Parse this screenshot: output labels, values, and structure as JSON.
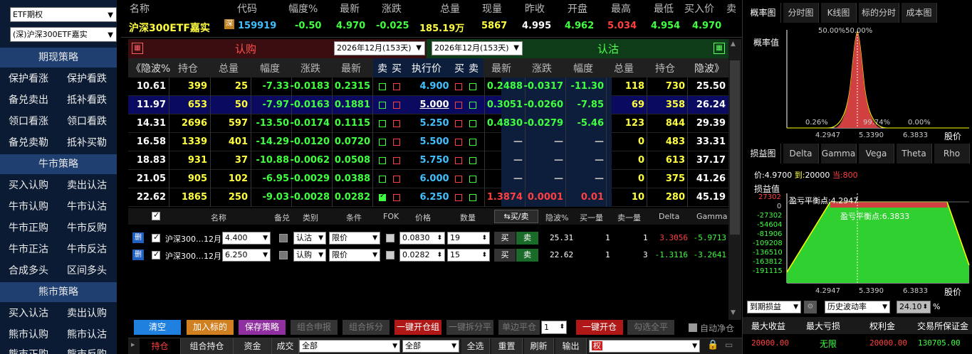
{
  "sidebar": {
    "product_select": "ETF期权",
    "underlying_select": "(深)沪深300ETF嘉实",
    "sections": [
      {
        "title": "期现策略",
        "items": [
          "保护看涨",
          "保护看跌",
          "备兑卖出",
          "抵补看跌",
          "领口看涨",
          "领口看跌",
          "备兑卖勒",
          "抵补买勒"
        ]
      },
      {
        "title": "牛市策略",
        "items": [
          "买入认购",
          "卖出认沽",
          "牛市认购",
          "牛市认沽",
          "牛市正购",
          "牛市反购",
          "牛市正沽",
          "牛市反沽",
          "合成多头",
          "区间多头"
        ]
      },
      {
        "title": "熊市策略",
        "items": [
          "买入认沽",
          "卖出认购",
          "熊市认购",
          "熊市认沽",
          "熊市正购",
          "熊市反购"
        ]
      }
    ]
  },
  "quote": {
    "headers": [
      "名称",
      "代码",
      "幅度%",
      "最新",
      "涨跌",
      "总量",
      "现量",
      "昨收",
      "开盘",
      "最高",
      "最低",
      "买入价",
      "卖"
    ],
    "name": "沪深300ETF嘉实",
    "tag": "深",
    "code": "159919",
    "change_pct": "-0.50",
    "last": "4.970",
    "change": "-0.025",
    "volume": "185.19万",
    "cur_vol": "5867",
    "prev_close": "4.995",
    "open": "4.962",
    "high": "5.034",
    "low": "4.954",
    "bid": "4.970"
  },
  "chain": {
    "call_label": "认购",
    "put_label": "认沽",
    "call_date": "2026年12月(153天)",
    "put_date": "2026年12月(153天)",
    "headers": [
      "《隐波%",
      "持仓",
      "总量",
      "幅度",
      "涨跌",
      "最新",
      "卖",
      "买",
      "执行价",
      "买",
      "卖",
      "最新",
      "涨跌",
      "幅度",
      "总量",
      "持仓",
      "隐波》"
    ],
    "rows": [
      {
        "c_iv": "10.61",
        "c_oi": "399",
        "c_vol": "25",
        "c_pct": "-7.33",
        "c_chg": "-0.0183",
        "c_last": "0.2315",
        "strike": "4.900",
        "p_last": "0.2488",
        "p_chg": "-0.0317",
        "p_pct": "-11.30",
        "p_vol": "118",
        "p_oi": "730",
        "p_iv": "25.50"
      },
      {
        "c_iv": "11.97",
        "c_oi": "653",
        "c_vol": "50",
        "c_pct": "-7.97",
        "c_chg": "-0.0163",
        "c_last": "0.1881",
        "strike": "5.000",
        "p_last": "0.3051",
        "p_chg": "-0.0260",
        "p_pct": "-7.85",
        "p_vol": "69",
        "p_oi": "358",
        "p_iv": "26.24"
      },
      {
        "c_iv": "14.31",
        "c_oi": "2696",
        "c_vol": "597",
        "c_pct": "-13.50",
        "c_chg": "-0.0174",
        "c_last": "0.1115",
        "strike": "5.250",
        "p_last": "0.4830",
        "p_chg": "-0.0279",
        "p_pct": "-5.46",
        "p_vol": "123",
        "p_oi": "844",
        "p_iv": "29.39"
      },
      {
        "c_iv": "16.58",
        "c_oi": "1339",
        "c_vol": "401",
        "c_pct": "-14.29",
        "c_chg": "-0.0120",
        "c_last": "0.0720",
        "strike": "5.500",
        "p_last": "—",
        "p_chg": "—",
        "p_pct": "—",
        "p_vol": "0",
        "p_oi": "483",
        "p_iv": "33.31"
      },
      {
        "c_iv": "18.83",
        "c_oi": "931",
        "c_vol": "37",
        "c_pct": "-10.88",
        "c_chg": "-0.0062",
        "c_last": "0.0508",
        "strike": "5.750",
        "p_last": "—",
        "p_chg": "—",
        "p_pct": "—",
        "p_vol": "0",
        "p_oi": "613",
        "p_iv": "37.17"
      },
      {
        "c_iv": "21.05",
        "c_oi": "905",
        "c_vol": "102",
        "c_pct": "-6.95",
        "c_chg": "-0.0029",
        "c_last": "0.0388",
        "strike": "6.000",
        "p_last": "—",
        "p_chg": "—",
        "p_pct": "—",
        "p_vol": "0",
        "p_oi": "375",
        "p_iv": "41.26"
      },
      {
        "c_iv": "22.62",
        "c_oi": "1865",
        "c_vol": "250",
        "c_pct": "-9.03",
        "c_chg": "-0.0028",
        "c_last": "0.0282",
        "strike": "6.250",
        "p_last": "1.3874",
        "p_chg": "0.0001",
        "p_pct": "0.01",
        "p_vol": "10",
        "p_oi": "280",
        "p_iv": "45.19"
      }
    ]
  },
  "orders": {
    "headers": [
      "名称",
      "备兑",
      "类别",
      "条件",
      "FOK",
      "价格",
      "数量",
      "买/卖",
      "隐波%",
      "买一量",
      "卖一量",
      "Delta",
      "Gamma"
    ],
    "del_label": "删",
    "buy_label": "买",
    "sell_label": "卖",
    "rows": [
      {
        "name": "沪深300…12月",
        "strike": "4.400",
        "type": "认沽",
        "cond": "限价",
        "price": "0.0830",
        "qty": "19",
        "iv": "25.31",
        "b1": "1",
        "s1": "1",
        "delta": "3.3056",
        "gamma": "-5.9713"
      },
      {
        "name": "沪深300…12月",
        "strike": "6.250",
        "type": "认购",
        "cond": "限价",
        "price": "0.0282",
        "qty": "15",
        "iv": "22.62",
        "b1": "1",
        "s1": "3",
        "delta": "-1.3116",
        "gamma": "-3.2641"
      }
    ]
  },
  "actions": {
    "clear": "清空",
    "add_underlying": "加入标的",
    "save_strategy": "保存策略",
    "combo_report": "组合申报",
    "combo_split": "组合拆分",
    "open_combo": "一键开仓组合",
    "split_flat": "一键拆分平仓",
    "single_flat": "单边平仓",
    "qty": "1",
    "open_one": "一键开仓",
    "check_flat": "勾选全平",
    "auto_net": "自动净仓"
  },
  "bottom_tabs": {
    "items": [
      "持仓",
      "组合持仓",
      "资金",
      "成交"
    ],
    "filter1": "全部",
    "filter2": "全部",
    "select_all": "全选",
    "reset": "重置",
    "refresh": "刷新",
    "export": "输出",
    "search": "权"
  },
  "right_panel": {
    "tabs1": [
      "概率图",
      "分时图",
      "K线图",
      "标的分时",
      "成本图"
    ],
    "prob": {
      "title": "概率值",
      "top_label": "50.00%50.00%",
      "left_pct": "0.26%",
      "mid_pct": "99.74%",
      "right_pct": "0.00%",
      "xticks": [
        "4.2947",
        "5.3390",
        "6.3833"
      ],
      "xlabel": "股价"
    },
    "tabs2": [
      "损益图",
      "Delta",
      "Gamma",
      "Vega",
      "Theta",
      "Rho"
    ],
    "pl": {
      "price_label": "价:",
      "price": "4.9700",
      "to_label": "到:",
      "to": "20000",
      "cur_label": "当:",
      "cur": "800",
      "ylabel": "损益值",
      "yticks": [
        "27302",
        "0",
        "-27302",
        "-54604",
        "-81906",
        "-109208",
        "-136510",
        "-163812",
        "-191115"
      ],
      "be1": "盈亏平衡点:4.2947",
      "be2": "盈亏平衡点:6.3833",
      "xticks": [
        "4.2947",
        "5.3390",
        "6.3833"
      ],
      "xlabel": "股价"
    },
    "selects": {
      "expiry": "到期损益",
      "vol": "历史波动率",
      "vol_val": "24.10",
      "unit": "%"
    },
    "summary": {
      "headers": [
        "最大收益",
        "最大亏损",
        "权利金",
        "交易所保证金"
      ],
      "values": [
        "20000.00",
        "无限",
        "20000.00",
        "130705.00"
      ]
    }
  },
  "colors": {
    "up": "#ff4040",
    "down": "#40ff40",
    "yellow": "#ffff00",
    "strike": "#40c0ff"
  }
}
